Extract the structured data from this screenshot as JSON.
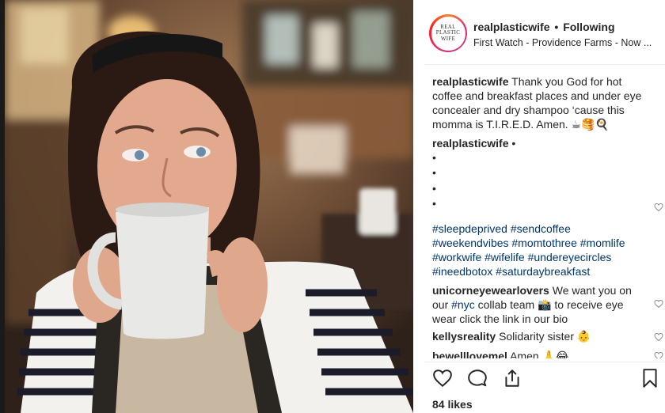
{
  "post": {
    "username": "realplasticwife",
    "separator": "•",
    "follow_status": "Following",
    "location": "First Watch - Providence Farms - Now ...",
    "avatar_text": [
      "REAL",
      "PLASTIC",
      "WIFE"
    ]
  },
  "caption": {
    "author": "realplasticwife",
    "text": "Thank you God for hot coffee and breakfast places and under eye concealer and dry shampoo ‘cause this momma is T.I.R.E.D. Amen. ☕🥞🍳",
    "bullets": [
      "•",
      "•",
      "•",
      "•"
    ],
    "hashtags_line1": "#sleepdeprived #sendcoffee",
    "hashtags_line2": "#weekendvibes #momtothree #momlife",
    "hashtags_line3": "#workwife #wifelife #undereyecircles",
    "hashtags_line4": "#ineedbotox #saturdaybreakfast"
  },
  "comments": [
    {
      "author": "unicorneyewearlovers",
      "text_before": "We want you on our",
      "tag": "#nyc",
      "text_after": "collab team 📸 to receive eye wear click the link in our bio"
    },
    {
      "author": "kellysreality",
      "text": "Solidarity sister 👶"
    },
    {
      "author": "bewelllovemel",
      "text": "Amen 🙏😂"
    }
  ],
  "likes": "84 likes",
  "icons": {
    "like": "heart-icon",
    "comment": "comment-icon",
    "share": "share-icon",
    "save": "bookmark-icon",
    "comment_like": "small-heart-icon"
  },
  "colors": {
    "hashtag": "#003569",
    "text": "#262626",
    "divider": "#efefef"
  }
}
